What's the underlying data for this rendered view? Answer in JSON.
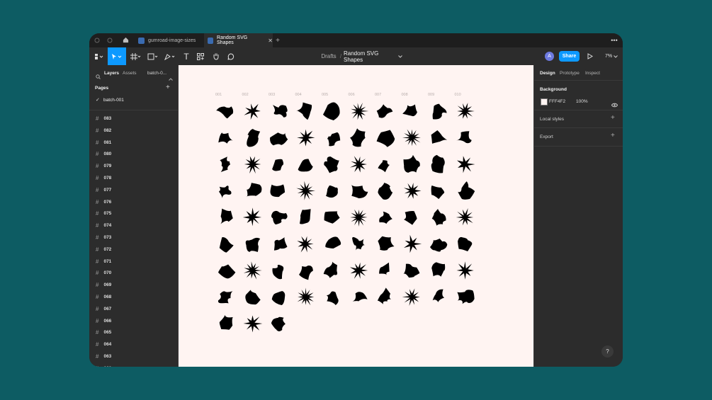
{
  "tabs": [
    {
      "label": "gumroad-image-sizes",
      "active": false
    },
    {
      "label": "Random SVG Shapes",
      "active": true
    }
  ],
  "toolbar": {
    "breadcrumb_root": "Drafts",
    "breadcrumb_sep": "/",
    "file_name": "Random SVG Shapes",
    "avatar_initial": "A",
    "share_label": "Share",
    "zoom": "7%"
  },
  "left_panel": {
    "tab_layers": "Layers",
    "tab_assets": "Assets",
    "page_selector": "batch-0...",
    "pages_title": "Pages",
    "current_page": "batch-001",
    "layers": [
      "083",
      "082",
      "081",
      "080",
      "079",
      "078",
      "077",
      "076",
      "075",
      "074",
      "073",
      "072",
      "071",
      "070",
      "069",
      "068",
      "067",
      "066",
      "065",
      "064",
      "063",
      "062"
    ]
  },
  "right_panel": {
    "tab_design": "Design",
    "tab_prototype": "Prototype",
    "tab_inspect": "Inspect",
    "background_title": "Background",
    "background_hex": "FFF4F2",
    "background_opacity": "100%",
    "local_styles": "Local styles",
    "export": "Export",
    "help": "?"
  },
  "canvas": {
    "background": "#fff4f2",
    "frame_count": 83,
    "columns": 10,
    "top_labels": [
      "001",
      "002",
      "003",
      "004",
      "005",
      "006",
      "007",
      "008",
      "009",
      "010"
    ]
  },
  "colors": {
    "page_bg": "#0d5c63",
    "accent": "#0d99ff",
    "panel": "#2c2c2c",
    "shape": "#000000"
  }
}
